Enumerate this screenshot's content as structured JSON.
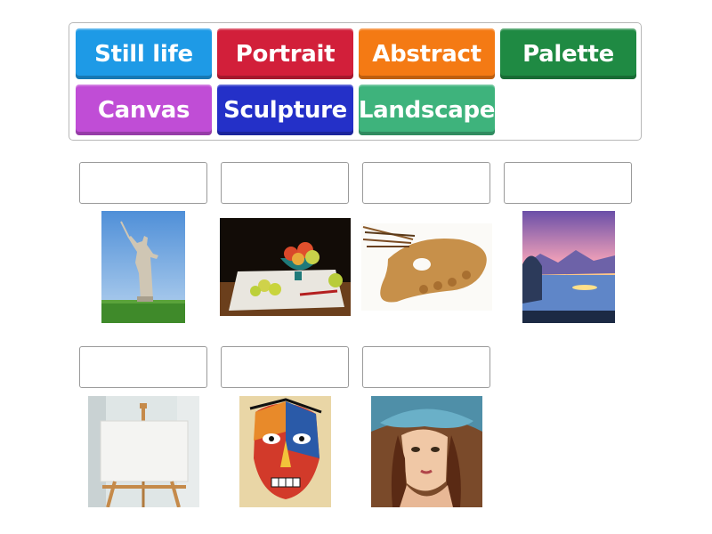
{
  "tiles": [
    {
      "label": "Still life",
      "color": "#1e9ae6"
    },
    {
      "label": "Portrait",
      "color": "#d21f3a"
    },
    {
      "label": "Abstract",
      "color": "#f47a14"
    },
    {
      "label": "Palette",
      "color": "#1f8a43"
    },
    {
      "label": "Canvas",
      "color": "#c04dd6"
    },
    {
      "label": "Sculpture",
      "color": "#2430c8"
    },
    {
      "label": "Landscape",
      "color": "#3eb37c"
    }
  ],
  "slots": [
    {
      "value": "",
      "image": "sculpture-statue"
    },
    {
      "value": "",
      "image": "still-life-apples"
    },
    {
      "value": "",
      "image": "paint-palette"
    },
    {
      "value": "",
      "image": "landscape-painting"
    },
    {
      "value": "",
      "image": "blank-canvas-easel"
    },
    {
      "value": "",
      "image": "abstract-face"
    },
    {
      "value": "",
      "image": "portrait-woman"
    }
  ]
}
